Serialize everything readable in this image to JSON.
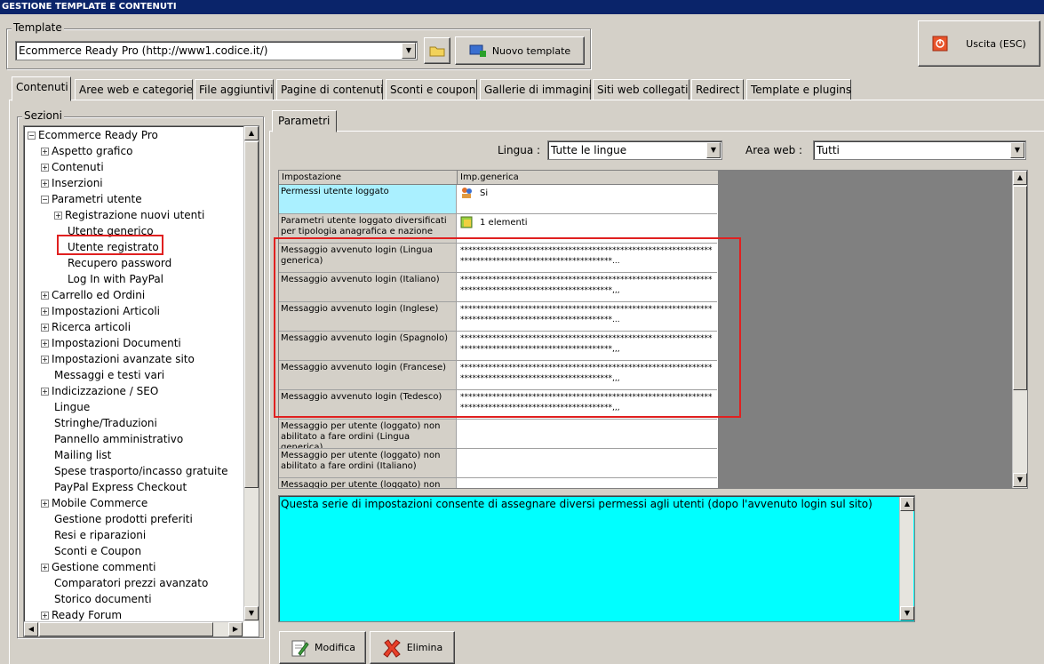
{
  "window": {
    "title": "GESTIONE TEMPLATE E CONTENUTI"
  },
  "template_group": {
    "label": "Template",
    "selected": "Ecommerce Ready Pro (http://www1.codice.it/)",
    "new_button": "Nuovo template"
  },
  "exit_button": "Uscita (ESC)",
  "tabs": [
    "Contenuti",
    "Aree web e categorie",
    "File aggiuntivi",
    "Pagine di contenuti",
    "Sconti e coupon",
    "Gallerie di immagini",
    "Siti web collegati",
    "Redirect",
    "Template e plugins"
  ],
  "sections": {
    "label": "Sezioni",
    "items": [
      "Ecommerce Ready Pro",
      "Aspetto grafico",
      "Contenuti",
      "Inserzioni",
      "Parametri utente",
      "Registrazione nuovi utenti",
      "Utente generico",
      "Utente registrato",
      "Recupero password",
      "Log In with PayPal",
      "Carrello ed Ordini",
      "Impostazioni Articoli",
      "Ricerca articoli",
      "Impostazioni Documenti",
      "Impostazioni avanzate sito",
      "Messaggi e testi vari",
      "Indicizzazione / SEO",
      "Lingue",
      "Stringhe/Traduzioni",
      "Pannello amministrativo",
      "Mailing list",
      "Spese trasporto/incasso gratuite",
      "PayPal Express Checkout",
      "Mobile Commerce",
      "Gestione prodotti preferiti",
      "Resi e riparazioni",
      "Sconti e Coupon",
      "Gestione commenti",
      "Comparatori prezzi avanzato",
      "Storico documenti",
      "Ready Forum"
    ]
  },
  "params": {
    "tab": "Parametri",
    "lingua_label": "Lingua :",
    "lingua_value": "Tutte le lingue",
    "area_label": "Area web :",
    "area_value": "Tutti",
    "col_setting": "Impostazione",
    "col_value": "Imp.generica",
    "rows": [
      {
        "name": "Permessi utente loggato",
        "value": "Si"
      },
      {
        "name": "Parametri utente loggato diversificati per tipologia anagrafica e nazione",
        "value": "1 elementi"
      },
      {
        "name": "Messaggio avvenuto login (Lingua generica)",
        "value": "*****************************************************************************************************..."
      },
      {
        "name": "Messaggio avvenuto login (Italiano)",
        "value": "*****************************************************************************************************,,,"
      },
      {
        "name": "Messaggio avvenuto login (Inglese)",
        "value": "*****************************************************************************************************..."
      },
      {
        "name": "Messaggio avvenuto login (Spagnolo)",
        "value": "*****************************************************************************************************,,,"
      },
      {
        "name": "Messaggio avvenuto login (Francese)",
        "value": "*****************************************************************************************************,,,"
      },
      {
        "name": "Messaggio avvenuto login (Tedesco)",
        "value": "*****************************************************************************************************,,,"
      },
      {
        "name": "Messaggio per utente (loggato) non abilitato a fare ordini (Lingua generica)",
        "value": ""
      },
      {
        "name": "Messaggio per utente (loggato) non abilitato a fare ordini (Italiano)",
        "value": ""
      },
      {
        "name": "Messaggio per utente (loggato) non",
        "value": ""
      }
    ],
    "description": "Questa serie di impostazioni consente di assegnare diversi permessi agli utenti (dopo l'avvenuto login sul sito)",
    "modify_button": "Modifica",
    "delete_button": "Elimina"
  }
}
